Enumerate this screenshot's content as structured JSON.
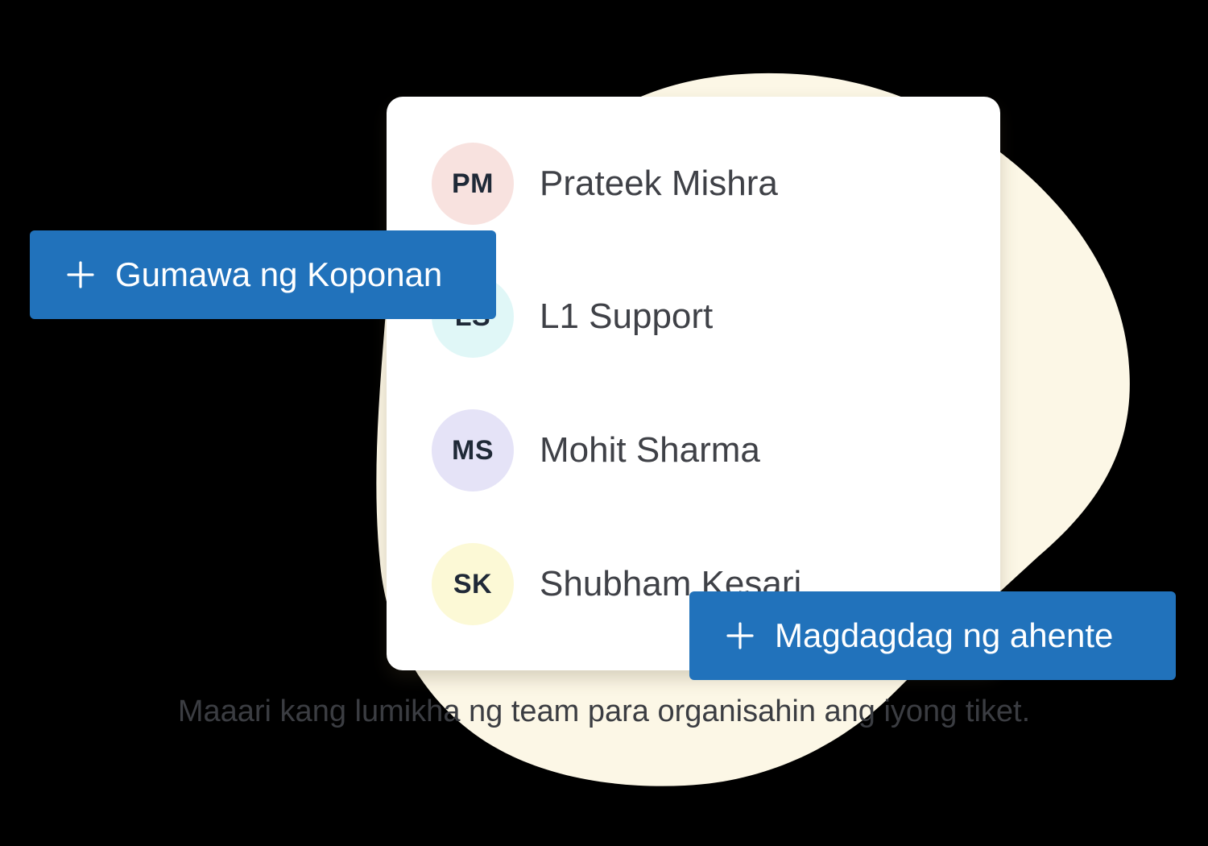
{
  "colors": {
    "background": "#000000",
    "blob": "#fcf7e6",
    "card": "#ffffff",
    "button": "#2172bb",
    "button_text": "#ffffff",
    "name_text": "#3f4147",
    "caption_text": "#3b3d42"
  },
  "members": [
    {
      "initials": "PM",
      "name": "Prateek Mishra",
      "avatar_color": "#f8e2df"
    },
    {
      "initials": "LS",
      "name": "L1 Support",
      "avatar_color": "#e0f7f7"
    },
    {
      "initials": "MS",
      "name": "Mohit Sharma",
      "avatar_color": "#e5e3f7"
    },
    {
      "initials": "SK",
      "name": "Shubham Kesari",
      "avatar_color": "#fcf9d6"
    }
  ],
  "buttons": {
    "create_team": {
      "label": "Gumawa ng Koponan",
      "icon": "plus-icon"
    },
    "add_agent": {
      "label": "Magdagdag ng ahente",
      "icon": "plus-icon"
    }
  },
  "caption": "Maaari kang lumikha ng team para organisahin ang iyong tiket."
}
